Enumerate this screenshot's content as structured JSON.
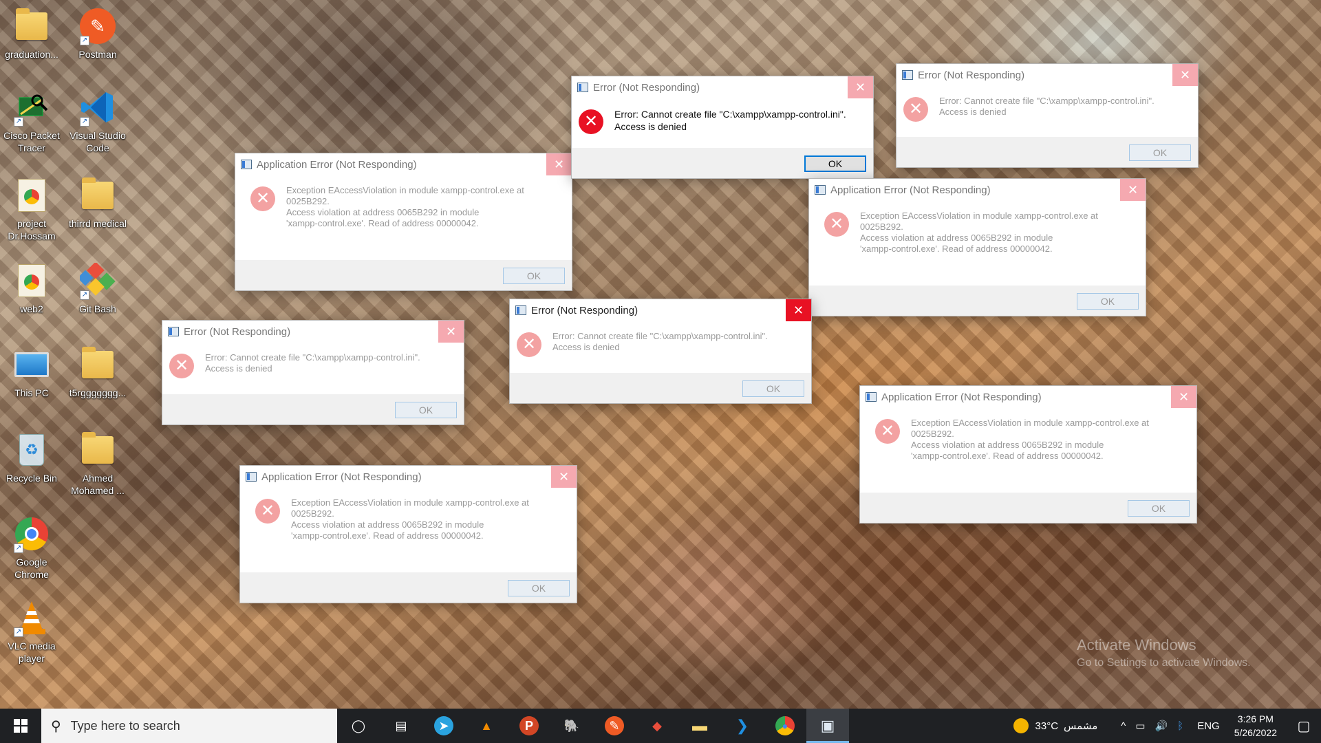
{
  "desktop": {
    "icons": [
      {
        "label": "graduation...",
        "icon": "folder-icon"
      },
      {
        "label": "Postman",
        "icon": "postman-icon"
      },
      {
        "label": "Cisco Packet Tracer",
        "icon": "cisco-packet-tracer-icon"
      },
      {
        "label": "Visual Studio Code",
        "icon": "vscode-icon"
      },
      {
        "label": "project Dr.Hossam",
        "icon": "chrome-html-icon"
      },
      {
        "label": "thirrd medical",
        "icon": "folder-icon"
      },
      {
        "label": "web2",
        "icon": "chrome-html-icon"
      },
      {
        "label": "Git Bash",
        "icon": "git-bash-icon"
      },
      {
        "label": "This PC",
        "icon": "this-pc-icon"
      },
      {
        "label": "t5rggggggg...",
        "icon": "folder-icon"
      },
      {
        "label": "Recycle Bin",
        "icon": "recycle-bin-icon"
      },
      {
        "label": "Ahmed Mohamed ...",
        "icon": "folder-icon"
      },
      {
        "label": "Google Chrome",
        "icon": "chrome-icon"
      },
      {
        "label": "VLC media player",
        "icon": "vlc-icon"
      }
    ],
    "watermark": {
      "line1": "Activate Windows",
      "line2": "Go to Settings to activate Windows."
    }
  },
  "dialogs": {
    "app_error_title": "Application Error (Not Responding)",
    "error_title": "Error (Not Responding)",
    "app_error_message": {
      "line1": "Exception EAccessViolation in module xampp-control.exe at",
      "line2": "0025B292.",
      "line3": "Access violation at address 0065B292 in module",
      "line4": "'xampp-control.exe'. Read of address 00000042."
    },
    "error_message": {
      "line1": "Error: Cannot create file \"C:\\xampp\\xampp-control.ini\".",
      "line2": "Access is denied"
    },
    "ok_label": "OK",
    "close_glyph": "✕",
    "error_glyph": "✕"
  },
  "taskbar": {
    "search_placeholder": "Type here to search",
    "pinned": [
      {
        "name": "cortana",
        "glyph": "◯"
      },
      {
        "name": "task-view",
        "glyph": "▤"
      },
      {
        "name": "telegram",
        "glyph": "➤"
      },
      {
        "name": "vlc",
        "glyph": "▲"
      },
      {
        "name": "powerpoint",
        "glyph": "P"
      },
      {
        "name": "postgresql",
        "glyph": "🐘"
      },
      {
        "name": "postman",
        "glyph": "✎"
      },
      {
        "name": "git",
        "glyph": "◆"
      },
      {
        "name": "file-explorer",
        "glyph": "▬"
      },
      {
        "name": "vscode",
        "glyph": "❯"
      },
      {
        "name": "chrome",
        "glyph": "●"
      },
      {
        "name": "xampp",
        "glyph": "▣"
      }
    ],
    "tray": {
      "weather_temp": "33°C",
      "weather_text": "مشمس",
      "chevron": "^",
      "battery": "▭",
      "volume": "🔊",
      "bluetooth": "ᛒ",
      "language": "ENG",
      "time": "3:26 PM",
      "date": "5/26/2022",
      "notification": "▢"
    }
  },
  "colors": {
    "taskbar_bg": "#1f2124",
    "close_active": "#e81123",
    "close_inactive": "#f5a9b0",
    "accent": "#0078d7"
  }
}
